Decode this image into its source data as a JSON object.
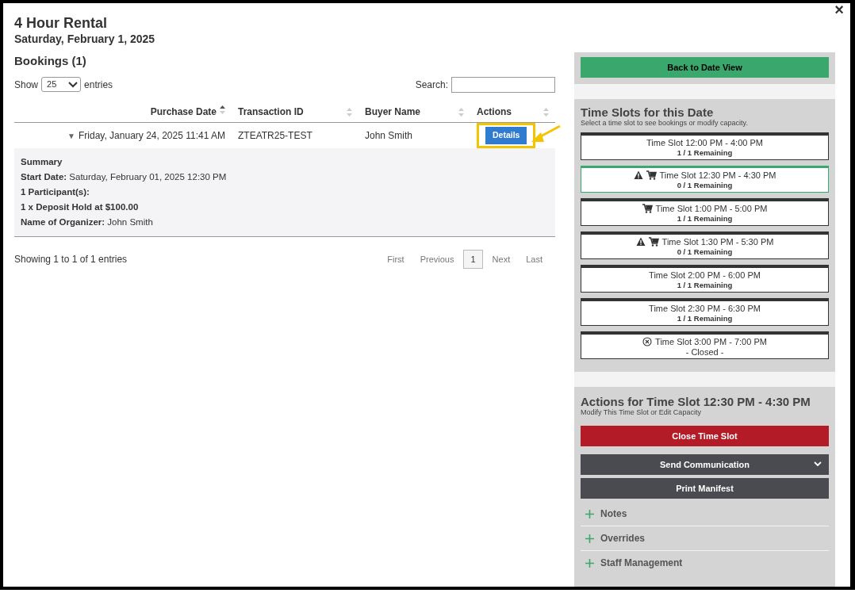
{
  "window": {
    "title": "4 Hour Rental",
    "subtitle": "Saturday, February 1, 2025",
    "close": "×"
  },
  "bookings": {
    "title": "Bookings (1)",
    "show_label": "Show",
    "page_size": "25",
    "entries_label": "entries",
    "search_label": "Search:",
    "columns": [
      {
        "label": "Purchase Date",
        "sorted": true
      },
      {
        "label": "Transaction ID",
        "sorted": false
      },
      {
        "label": "Buyer Name",
        "sorted": false
      },
      {
        "label": "Actions",
        "sorted": false
      }
    ],
    "rows": [
      {
        "expanded": true,
        "toggle": "▼",
        "purchase_date": "Friday, January 24, 2025 11:41 AM",
        "transaction_id": "ZTEATR25-TEST",
        "buyer": "John Smith",
        "action": "Details",
        "highlighted": true,
        "details": [
          "**Summary**",
          "**Start Date:** Saturday, February 01, 2025 12:30 PM",
          "**1 Participant(s):**",
          "**1 x Deposit Hold at $100.00**",
          "**Name of Organizer:** John Smith"
        ]
      }
    ],
    "info": "Showing 1 to 1 of 1 entries",
    "pagination": [
      {
        "label": "First",
        "selected": false
      },
      {
        "label": "Previous",
        "selected": false
      },
      {
        "label": "1",
        "selected": true
      },
      {
        "label": "Next",
        "selected": false
      },
      {
        "label": "Last",
        "selected": false
      }
    ]
  },
  "back_button": "Back to Date View",
  "time_slots": {
    "title": "Time Slots for this Date",
    "subtitle": "Select a time slot to see bookings or modify capacity.",
    "items": [
      {
        "label": "Time Slot 12:00 PM - 4:00 PM",
        "status": "1 / 1 Remaining",
        "selected": false,
        "warning": false,
        "cart": false,
        "closed": false
      },
      {
        "label": "Time Slot 12:30 PM - 4:30 PM",
        "status": "0 / 1 Remaining",
        "selected": true,
        "warning": true,
        "cart": true,
        "closed": false
      },
      {
        "label": "Time Slot 1:00 PM - 5:00 PM",
        "status": "1 / 1 Remaining",
        "selected": false,
        "warning": false,
        "cart": true,
        "closed": false
      },
      {
        "label": "Time Slot 1:30 PM - 5:30 PM",
        "status": "0 / 1 Remaining",
        "selected": false,
        "warning": true,
        "cart": true,
        "closed": false
      },
      {
        "label": "Time Slot 2:00 PM - 6:00 PM",
        "status": "1 / 1 Remaining",
        "selected": false,
        "warning": false,
        "cart": false,
        "closed": false
      },
      {
        "label": "Time Slot 2:30 PM - 6:30 PM",
        "status": "1 / 1 Remaining",
        "selected": false,
        "warning": false,
        "cart": false,
        "closed": false
      },
      {
        "label": "Time Slot 3:00 PM - 7:00 PM",
        "status": "- Closed -",
        "selected": false,
        "warning": false,
        "cart": false,
        "closed": true
      }
    ]
  },
  "actions": {
    "title": "Actions for Time Slot 12:30 PM - 4:30 PM",
    "subtitle": "Modify This Time Slot or Edit Capacity",
    "buttons": [
      {
        "label": "Close Time Slot",
        "kind": "danger",
        "dropdown": false
      },
      {
        "label": "Send Communication",
        "kind": "dark",
        "dropdown": true
      },
      {
        "label": "Print Manifest",
        "kind": "dark",
        "dropdown": false
      }
    ],
    "sections": [
      {
        "label": "Notes",
        "expanded": false
      },
      {
        "label": "Overrides",
        "expanded": false
      },
      {
        "label": "Staff Management",
        "expanded": false
      }
    ]
  }
}
